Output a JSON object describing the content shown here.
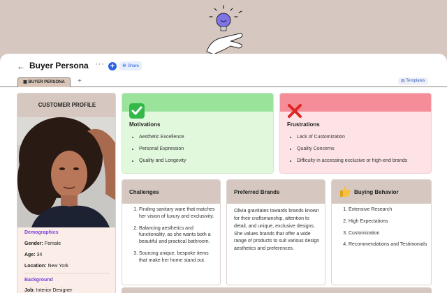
{
  "header": {
    "title": "Buyer Persona",
    "share_label": "Share",
    "tab_label": "BUYER PERSONA",
    "templates_label": "Templates"
  },
  "profile": {
    "title": "CUSTOMER PROFILE",
    "demographics_label": "Demographics",
    "gender_key": "Gender:",
    "gender_value": "Female",
    "age_key": "Age:",
    "age_value": "34",
    "location_key": "Location:",
    "location_value": "New York",
    "background_label": "Background",
    "job_key": "Job:",
    "job_value": "Interior Designer"
  },
  "motivations": {
    "title": "Motivations",
    "items": [
      "Aesthetic Excellence",
      "Personal Expression",
      "Quality and Longevity"
    ]
  },
  "frustrations": {
    "title": "Frustrations",
    "items": [
      "Lack of Customization",
      "Quality Concerns",
      "Difficulty in accessing exclusive or high-end brands"
    ]
  },
  "challenges": {
    "title": "Challenges",
    "items": [
      "Finding sanitary ware that matches her vision of luxury and exclusivity.",
      "Balancing aesthetics and functionality, as she wants both a beautiful and practical bathroom.",
      "Sourcing unique, bespoke items that make her home stand out."
    ]
  },
  "preferred_brands": {
    "title": "Preferred Brands",
    "text": "Olivia gravitates towards brands known for their craftsmanship, attention to detail, and unique, exclusive designs. She values brands that offer a wide range of products to suit various design aesthetics and preferences."
  },
  "buying_behavior": {
    "title": "Buying Behavior",
    "items": [
      "Extensive Research",
      "High Expectations",
      "Customization",
      "Recommendations and Testimonials"
    ]
  },
  "colors": {
    "accent": "#2b62e0",
    "section_label": "#7a3fd2",
    "motivations_head": "#9ae39b",
    "frustrations_head": "#f48d98",
    "neutral_head": "#d6c8c0"
  },
  "icons": {
    "back": "back-arrow-icon",
    "more": "more-icon",
    "add": "plus-icon",
    "share": "globe-icon",
    "templates": "templates-icon",
    "motivations": "check-mark-icon",
    "frustrations": "cross-mark-icon",
    "buying": "thumbs-up-icon",
    "hero": "lightbulb-hand-icon"
  }
}
